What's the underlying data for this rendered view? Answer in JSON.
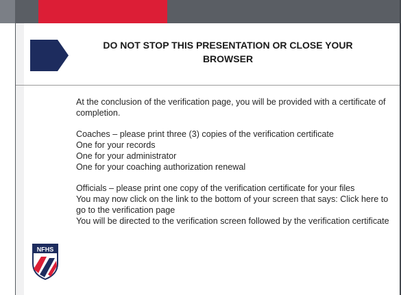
{
  "slide": {
    "title": "DO NOT STOP THIS PRESENTATION OR CLOSE YOUR BROWSER",
    "paragraphs": [
      "At the conclusion of the verification page, you will be provided with a certificate of completion.",
      "",
      "Coaches – please print three (3) copies of the verification certificate",
      "One for your records",
      "One for your administrator",
      "One for your coaching authorization renewal",
      "",
      "Officials – please print one copy of the verification certificate for your files",
      "You may now click on the link to the bottom of your screen that says: Click here to go to the verification page",
      "You will be directed to the verification screen followed by the verification certificate"
    ],
    "logo_text": "NFHS"
  },
  "colors": {
    "top_bar": "#5a5e64",
    "accent_red": "#dc1e36",
    "navy": "#1d2c5e"
  },
  "icons": {
    "arrow": "navy-pentagon-arrow",
    "logo": "nfhs-shield-logo"
  }
}
